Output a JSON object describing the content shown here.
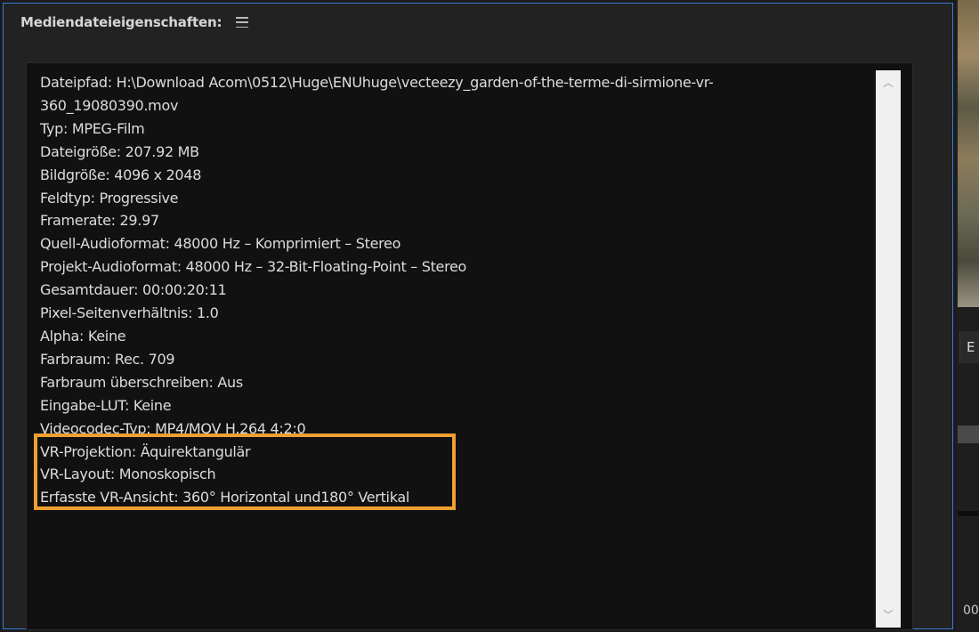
{
  "panel": {
    "title": "Mediendateieigenschaften:",
    "menu_icon": "hamburger-menu-icon"
  },
  "properties": {
    "lines": [
      "Dateipfad: H:\\Download Acom\\0512\\Huge\\ENUhuge\\vecteezy_garden-of-the-terme-di-sirmione-vr-",
      "360_19080390.mov",
      "Typ: MPEG-Film",
      "Dateigröße: 207.92 MB",
      "Bildgröße: 4096 x 2048",
      "Feldtyp: Progressive",
      "Framerate: 29.97",
      "Quell-Audioformat: 48000 Hz – Komprimiert – Stereo",
      "Projekt-Audioformat: 48000 Hz – 32-Bit-Floating-Point – Stereo",
      "Gesamtdauer: 00:00:20:11",
      "Pixel-Seitenverhältnis: 1.0",
      "Alpha: Keine",
      "Farbraum: Rec. 709",
      "Farbraum überschreiben: Aus",
      "Eingabe-LUT: Keine",
      "Videocodec-Typ: MP4/MOV H.264 4:2:0",
      "VR-Projektion: Äquirektangulär",
      "VR-Layout: Monoskopisch",
      "Erfasste VR-Ansicht: 360° Horizontal und180° Vertikal"
    ],
    "highlight_color": "#f0a030"
  },
  "scrollbar": {
    "up_icon": "chevron-up-icon",
    "down_icon": "chevron-down-icon",
    "up_glyph": "︿",
    "down_glyph": "﹀"
  },
  "right_panel": {
    "tab_label": "E",
    "time_text": "00"
  },
  "colors": {
    "accent_border": "#3a7bd5",
    "panel_bg": "#222222",
    "text_area_bg": "#111111",
    "text": "#dcdcdc"
  }
}
